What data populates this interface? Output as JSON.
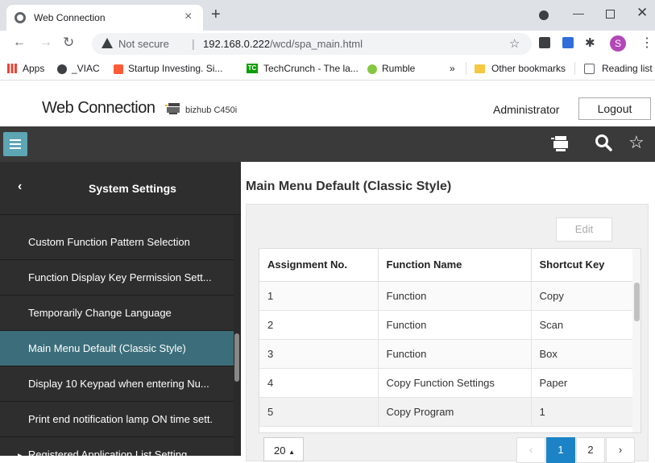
{
  "browser": {
    "tab_title": "Web Connection",
    "tab_close": "×",
    "new_tab": "+",
    "not_secure": "Not secure",
    "url_host": "192.168.0.222",
    "url_path": "/wcd/spa_main.html",
    "profile_initial": "S",
    "bookmarks": {
      "apps": "Apps",
      "viac": "_VIAC",
      "startup": "Startup Investing. Si...",
      "techcrunch": "TechCrunch - The la...",
      "rumble": "Rumble",
      "overflow": "»",
      "other": "Other bookmarks",
      "reading": "Reading list"
    }
  },
  "header": {
    "brand": "Web Connection",
    "device": "bizhub C450i",
    "user": "Administrator",
    "logout_label": "Logout"
  },
  "sidebar": {
    "title": "System Settings",
    "items": [
      {
        "label": "Custom Function Pattern Selection"
      },
      {
        "label": "Function Display Key Permission Sett..."
      },
      {
        "label": "Temporarily Change Language"
      },
      {
        "label": "Main Menu Default (Classic Style)"
      },
      {
        "label": "Display 10 Keypad when entering Nu..."
      },
      {
        "label": "Print end notification lamp ON time sett."
      },
      {
        "label": "Registered Application List Setting"
      }
    ]
  },
  "main": {
    "title": "Main Menu Default (Classic Style)",
    "edit_label": "Edit",
    "table": {
      "headers": [
        "Assignment No.",
        "Function Name",
        "Shortcut Key"
      ],
      "rows": [
        [
          "1",
          "Function",
          "Copy"
        ],
        [
          "2",
          "Function",
          "Scan"
        ],
        [
          "3",
          "Function",
          "Box"
        ],
        [
          "4",
          "Copy Function Settings",
          "Paper"
        ],
        [
          "5",
          "Copy Program",
          "1"
        ]
      ]
    },
    "pager": {
      "page_size": "20",
      "pages": [
        "1",
        "2"
      ]
    }
  },
  "colors": {
    "accent": "#1c84c6",
    "sidebar_active": "#3b6e7a",
    "hamburger": "#5da6b4"
  }
}
